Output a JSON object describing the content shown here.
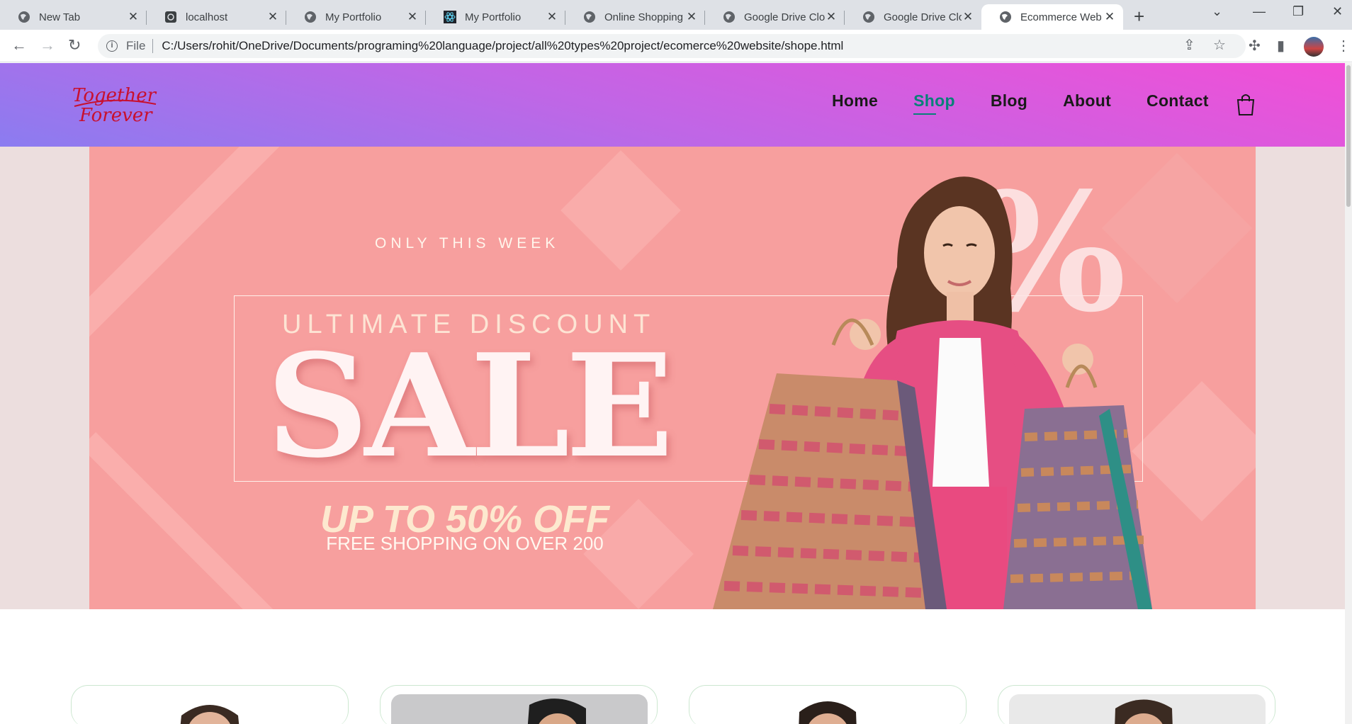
{
  "browser": {
    "tabs": [
      {
        "title": "New Tab",
        "icon": "globe-icon",
        "active": false
      },
      {
        "title": "localhost",
        "icon": "app-icon",
        "active": false
      },
      {
        "title": "My Portfolio",
        "icon": "globe-icon",
        "active": false
      },
      {
        "title": "My Portfolio",
        "icon": "react-icon",
        "active": false
      },
      {
        "title": "Online Shopping",
        "icon": "globe-icon",
        "active": false
      },
      {
        "title": "Google Drive Clo",
        "icon": "globe-icon",
        "active": false
      },
      {
        "title": "Google Drive Clo",
        "icon": "globe-icon",
        "active": false
      },
      {
        "title": "Ecommerce Web",
        "icon": "globe-icon",
        "active": true
      }
    ],
    "address": {
      "scheme": "File",
      "url": "C:/Users/rohit/OneDrive/Documents/programing%20language/project/all%20types%20project/ecomerce%20website/shope.html"
    }
  },
  "site": {
    "logo": {
      "line1": "Together",
      "line2": "Forever"
    },
    "nav": [
      {
        "label": "Home",
        "active": false
      },
      {
        "label": "Shop",
        "active": true
      },
      {
        "label": "Blog",
        "active": false
      },
      {
        "label": "About",
        "active": false
      },
      {
        "label": "Contact",
        "active": false
      }
    ],
    "accent_color": "#088178",
    "hero": {
      "eyebrow": "ONLY THIS WEEK",
      "subtitle": "ULTIMATE DISCOUNT",
      "headline": "SALE",
      "offer": "UP TO 50% OFF",
      "note": "FREE SHOPPING ON OVER 200",
      "background": "#f79f9e"
    },
    "product_cards": 4
  }
}
